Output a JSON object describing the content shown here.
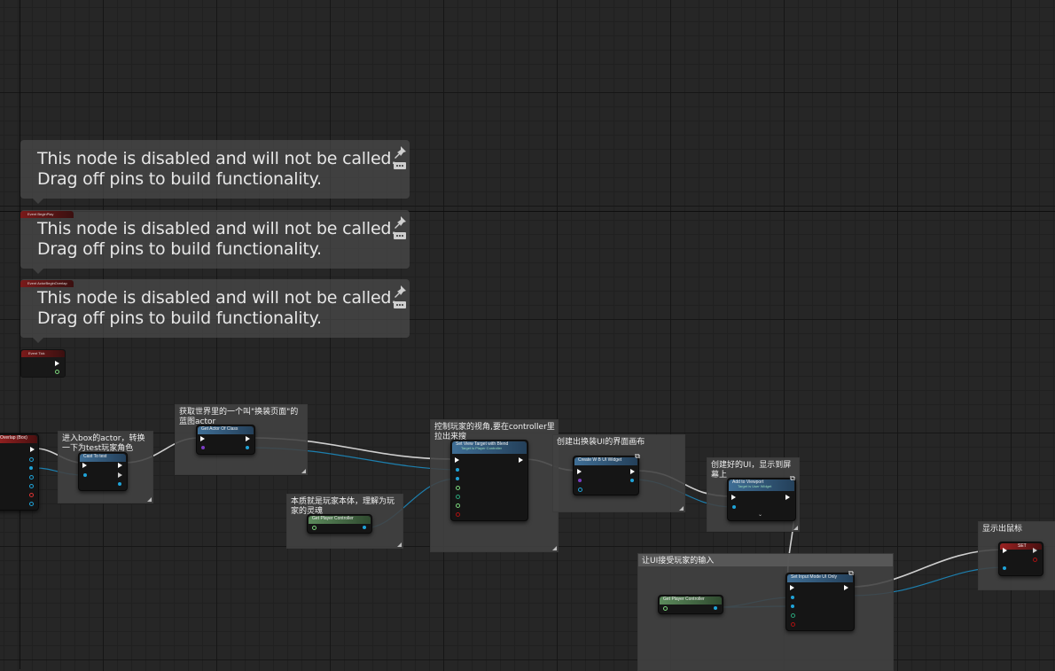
{
  "disabled_tooltip": {
    "line1": "This node is disabled and will not be called.",
    "line2": "Drag off pins to build functionality."
  },
  "event_nodes": [
    {
      "label": "Event BeginPlay"
    },
    {
      "label": "Event ActorBeginOverlap"
    },
    {
      "label": "Event Tick"
    }
  ],
  "overlap_node": {
    "label": "Overlap (Box)"
  },
  "comments": {
    "cast": "进入box的actor，转换一下为test玩家角色",
    "get_actor": "获取世界里的一个叫\"换装页面\"的\n蓝图actor",
    "controller": "本质就是玩家本体，理解为玩\n家的灵魂",
    "view_target": "控制玩家的视角,要在controller里\n拉出来搜",
    "create_ui": "创建出换装UI的界面画布",
    "add_viewport": "创建好的UI，显示到屏\n幕上",
    "input_mode": "让UI接受玩家的输入",
    "show_cursor": "显示出鼠标"
  },
  "nodes": {
    "cast": {
      "title": "Cast To test"
    },
    "get_actor": {
      "title": "Get Actor Of Class"
    },
    "get_pc1": {
      "title": "Get Player Controller"
    },
    "view_target": {
      "title": "Set View Target with Blend",
      "sub": "Target is Player Controller"
    },
    "create_widget": {
      "title": "Create W B UI Widget"
    },
    "add_viewport": {
      "title": "Add to Viewport",
      "sub": "Target is User Widget"
    },
    "get_pc2": {
      "title": "Get Player Controller"
    },
    "input_mode": {
      "title": "Set Input Mode UI Only"
    },
    "set_node": {
      "title": "SET"
    }
  },
  "colors": {
    "exec": "#ffffff",
    "object_pin": "#1fa3d8",
    "event_header": "#7a1a1a",
    "function_header": "#3f6e95",
    "pure_header": "#5c8a5c",
    "comment_bg": "#424242"
  }
}
